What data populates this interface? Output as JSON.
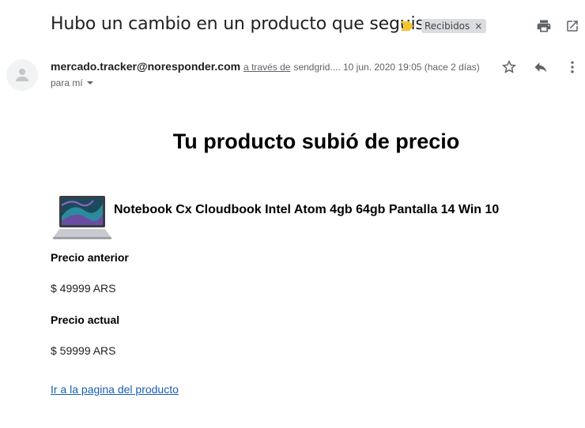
{
  "email": {
    "subject": "Hubo un cambio en un producto que seguis",
    "label": "Recibidos",
    "label_remove": "×",
    "sender_email": "mercado.tracker@noresponder.com",
    "via_text": "a través de",
    "via_domain": "sendgrid....",
    "date": "10 jun. 2020 19:05 (hace 2 días)",
    "to_text": "para mí"
  },
  "body": {
    "headline": "Tu producto subió de precio",
    "product_name": "Notebook Cx Cloudbook Intel Atom 4gb 64gb Pantalla 14 Win 10",
    "previous_price_label": "Precio anterior",
    "previous_price": "$ 49999 ARS",
    "current_price_label": "Precio actual",
    "current_price": "$ 59999 ARS",
    "product_link": "Ir a la pagina del producto"
  },
  "icons": {
    "importance": "importance-marker-icon",
    "print": "print-icon",
    "open_new_window": "open-in-new-window-icon",
    "avatar": "person-avatar-icon",
    "star": "star-icon",
    "reply": "reply-icon",
    "more": "more-vertical-icon",
    "dropdown": "dropdown-arrow-icon",
    "product": "laptop-image"
  },
  "colors": {
    "importance": "#f4c430",
    "link": "#1a5fb4",
    "chip_bg": "#dadce0"
  }
}
